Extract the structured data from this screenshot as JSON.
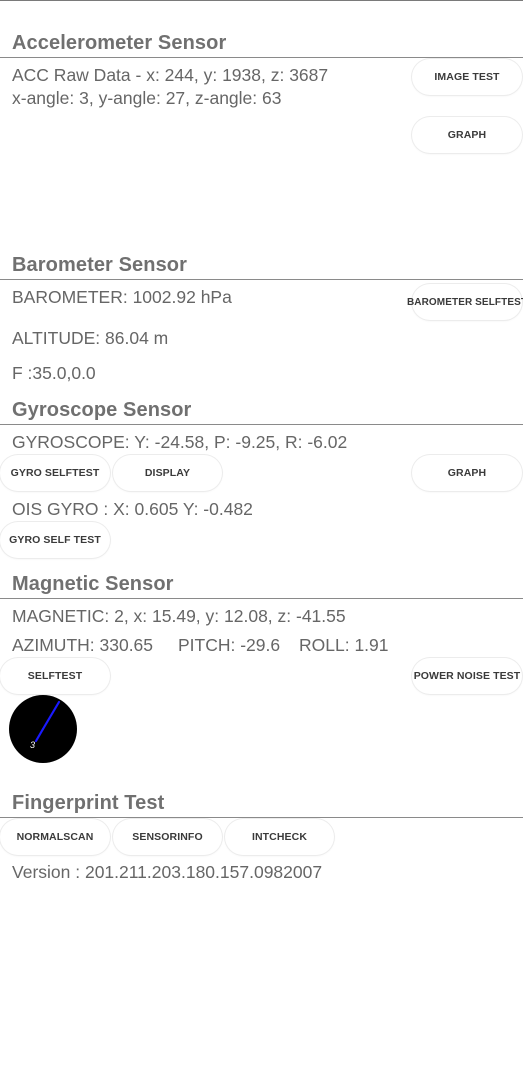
{
  "accelerometer": {
    "title": "Accelerometer Sensor",
    "raw": "ACC Raw Data - x: 244, y: 1938, z: 3687",
    "angles": "x-angle: 3, y-angle: 27, z-angle: 63",
    "image_test_label": "IMAGE TEST",
    "graph_label": "GRAPH"
  },
  "barometer": {
    "title": "Barometer Sensor",
    "value": "BAROMETER: 1002.92 hPa",
    "altitude": "ALTITUDE: 86.04 m",
    "f_value": "F :35.0,0.0",
    "selftest_label": "BAROMETER SELFTEST"
  },
  "gyroscope": {
    "title": "Gyroscope Sensor",
    "value": "GYROSCOPE: Y: -24.58, P: -9.25, R: -6.02",
    "gyro_selftest_label": "GYRO SELFTEST",
    "display_label": "DISPLAY",
    "graph_label": "GRAPH",
    "ois": "OIS GYRO : X: 0.605 Y: -0.482",
    "gyro_self_test_label": "GYRO SELF TEST"
  },
  "magnetic": {
    "title": "Magnetic Sensor",
    "value": "MAGNETIC: 2, x: 15.49, y: 12.08, z: -41.55",
    "azimuth": "AZIMUTH: 330.65",
    "pitch": "PITCH: -29.6",
    "roll": "ROLL: 1.91",
    "selftest_label": "SELFTEST",
    "power_noise_label": "POWER NOISE TEST",
    "compass_label": "3",
    "compass_needle_color": "#1a1aff"
  },
  "fingerprint": {
    "title": "Fingerprint Test",
    "normalscan_label": "NORMALSCAN",
    "sensorinfo_label": "SENSORINFO",
    "intcheck_label": "INTCHECK",
    "version": "Version : 201.211.203.180.157.0982007"
  }
}
